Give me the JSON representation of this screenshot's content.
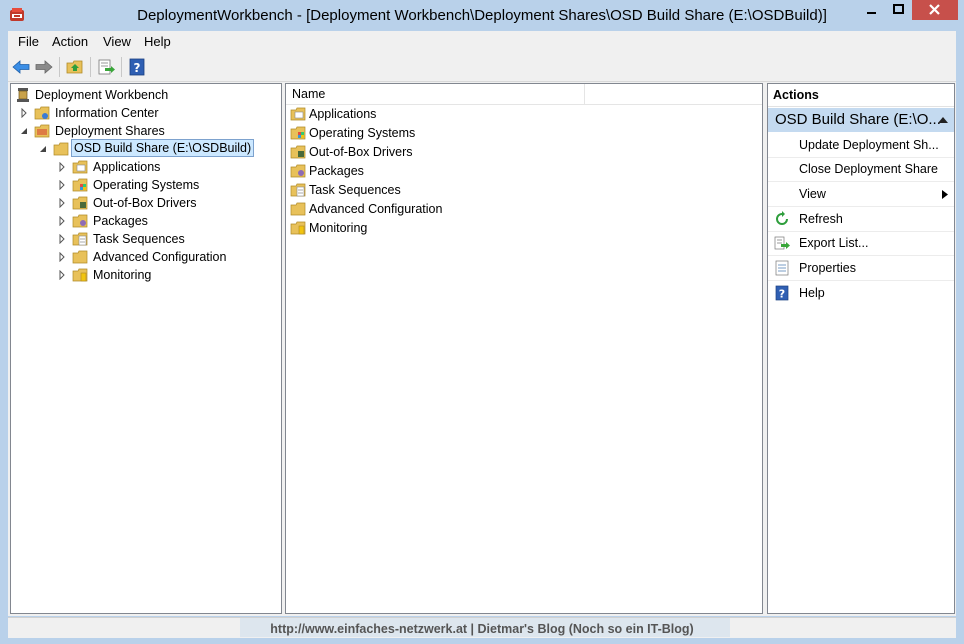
{
  "window": {
    "title": "DeploymentWorkbench - [Deployment Workbench\\Deployment Shares\\OSD Build Share (E:\\OSDBuild)]"
  },
  "menu": [
    "File",
    "Action",
    "View",
    "Help"
  ],
  "toolbar": {
    "icons": [
      "back-arrow-icon",
      "forward-arrow-icon",
      "up-folder-icon",
      "export-list-icon",
      "help-icon"
    ]
  },
  "tree": {
    "root": "Deployment Workbench",
    "information_center": "Information Center",
    "deployment_shares": "Deployment Shares",
    "selected_share": "OSD Build Share (E:\\OSDBuild)",
    "children": [
      "Applications",
      "Operating Systems",
      "Out-of-Box Drivers",
      "Packages",
      "Task Sequences",
      "Advanced Configuration",
      "Monitoring"
    ]
  },
  "list": {
    "column_name": "Name",
    "items": [
      "Applications",
      "Operating Systems",
      "Out-of-Box Drivers",
      "Packages",
      "Task Sequences",
      "Advanced Configuration",
      "Monitoring"
    ]
  },
  "actions": {
    "header": "Actions",
    "section_title": "OSD Build Share (E:\\O...",
    "items": [
      "Update Deployment Sh...",
      "Close Deployment Share",
      "View",
      "Refresh",
      "Export List...",
      "Properties",
      "Help"
    ]
  },
  "status": {
    "watermark": "http://www.einfaches-netzwerk.at | Dietmar's Blog (Noch so ein IT-Blog)"
  },
  "colors": {
    "chrome": "#b9d1ea",
    "close_button": "#c7504b",
    "selection": "#cce8ff",
    "actions_section": "#c4daf0"
  }
}
